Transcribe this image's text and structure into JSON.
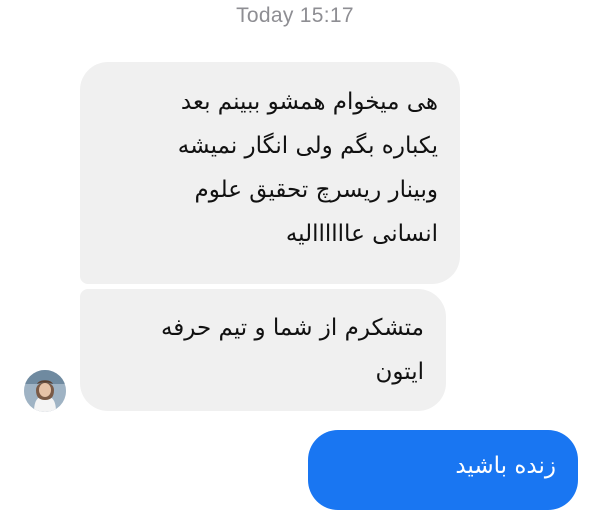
{
  "conversation": {
    "timestamp": "Today 15:17",
    "messages": [
      {
        "direction": "received",
        "lines": [
          "هی میخوام همشو ببینم بعد",
          "یکباره بگم ولی انگار نمیشه",
          "وبینار ریسرچ تحقیق علوم",
          "انسانی عاااااالیه"
        ]
      },
      {
        "direction": "received",
        "lines": [
          "متشکرم از شما و تیم حرفه",
          "ایتون"
        ]
      },
      {
        "direction": "sent",
        "lines": [
          "زنده باشید"
        ]
      }
    ]
  },
  "colors": {
    "received_bubble": "#f0f0f0",
    "sent_bubble": "#1976f2",
    "timestamp_text": "#8e8e93"
  },
  "icons": {
    "sender_avatar": "avatar"
  }
}
